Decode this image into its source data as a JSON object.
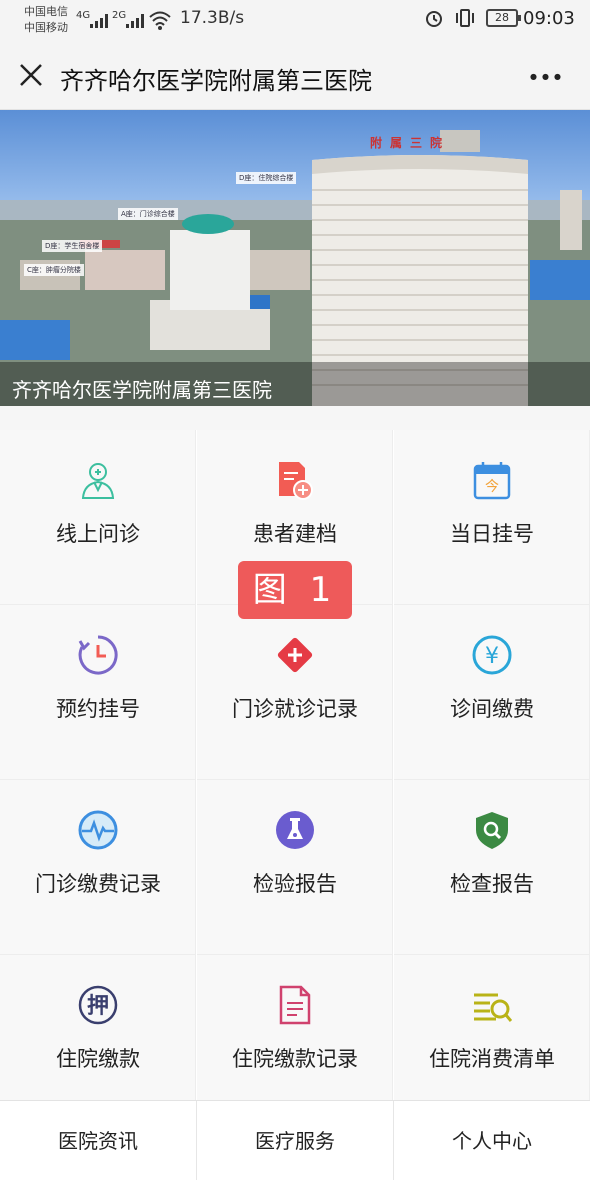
{
  "status_bar": {
    "carrier_1": "中国电信",
    "carrier_2": "中国移动",
    "sig_1_label": "4G",
    "sig_2_label": "2G",
    "net_speed": "17.3B/s",
    "battery": "28",
    "time": "09:03"
  },
  "title_bar": {
    "title": "齐齐哈尔医学院附属第三医院"
  },
  "banner": {
    "caption": "齐齐哈尔医学院附属第三医院",
    "building_labels": [
      "D座：住院综合楼",
      "A座：门诊综合楼",
      "D座：学生宿舍楼",
      "C座：肿瘤分院楼"
    ],
    "sign_text": "附属三院"
  },
  "grid": {
    "items": [
      {
        "label": "线上问诊",
        "icon": "doctor-icon"
      },
      {
        "label": "患者建档",
        "icon": "add-file-icon"
      },
      {
        "label": "当日挂号",
        "icon": "calendar-today-icon"
      },
      {
        "label": "预约挂号",
        "icon": "clock-appointment-icon"
      },
      {
        "label": "门诊就诊记录",
        "icon": "medical-cross-icon"
      },
      {
        "label": "诊间缴费",
        "icon": "yuan-icon"
      },
      {
        "label": "门诊缴费记录",
        "icon": "heartbeat-icon"
      },
      {
        "label": "检验报告",
        "icon": "lab-test-icon"
      },
      {
        "label": "检查报告",
        "icon": "shield-search-icon"
      },
      {
        "label": "住院缴款",
        "icon": "deposit-icon"
      },
      {
        "label": "住院缴款记录",
        "icon": "document-icon"
      },
      {
        "label": "住院消费清单",
        "icon": "list-search-icon"
      }
    ],
    "deposit_char": "押",
    "today_char": "今",
    "yuan_char": "¥"
  },
  "figure_badge": "图 1",
  "bottom_nav": {
    "items": [
      "医院资讯",
      "医疗服务",
      "个人中心"
    ]
  }
}
